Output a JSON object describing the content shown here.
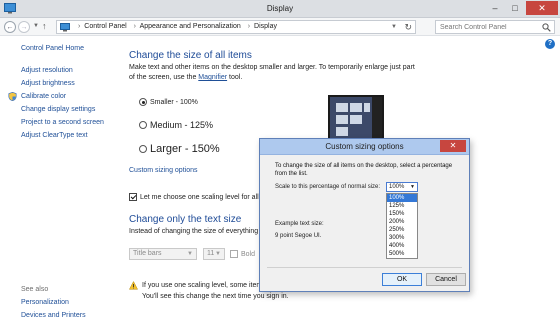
{
  "window": {
    "title": "Display"
  },
  "address": {
    "crumbs": [
      "Control Panel",
      "Appearance and Personalization",
      "Display"
    ],
    "search_placeholder": "Search Control Panel"
  },
  "leftnav": {
    "home": "Control Panel Home",
    "links": [
      "Adjust resolution",
      "Adjust brightness",
      "Calibrate color",
      "Change display settings",
      "Project to a second screen",
      "Adjust ClearType text"
    ],
    "see_also_label": "See also",
    "see_also": [
      "Personalization",
      "Devices and Printers"
    ]
  },
  "main": {
    "heading": "Change the size of all items",
    "desc_part1": "Make text and other items on the desktop smaller and larger. To temporarily enlarge just part of the screen,",
    "desc_part2_prefix": "use the ",
    "magnifier_link": "Magnifier",
    "desc_part2_suffix": " tool.",
    "options": [
      {
        "label": "Smaller - 100%",
        "selected": true
      },
      {
        "label": "Medium - 125%",
        "selected": false
      },
      {
        "label": "Larger - 150%",
        "selected": false
      }
    ],
    "custom_link": "Custom sizing options",
    "letme_label": "Let me choose one scaling level for all my",
    "text_heading": "Change only the text size",
    "text_desc": "Instead of changing the size of everything on",
    "item_select": "Title bars",
    "size_select": "11",
    "bold_label": "Bold",
    "warning_line1": "If you use one scaling level, some items",
    "warning_line2": "You'll see this change the next time you sign in."
  },
  "dialog": {
    "title": "Custom sizing options",
    "description": "To change the size of all items on the desktop, select a percentage from the list.",
    "scale_label": "Scale to this percentage of normal size:",
    "selected_value": "100%",
    "options": [
      "100%",
      "125%",
      "150%",
      "200%",
      "250%",
      "300%",
      "400%",
      "500%"
    ],
    "example_label": "Example text size:",
    "example_font": "9 point Segoe UI.",
    "ok_label": "OK",
    "cancel_label": "Cancel"
  },
  "colors": {
    "link": "#1f4f97",
    "heading": "#1e4b97",
    "dialog_title": "#aec9ee",
    "close": "#c7463f"
  }
}
